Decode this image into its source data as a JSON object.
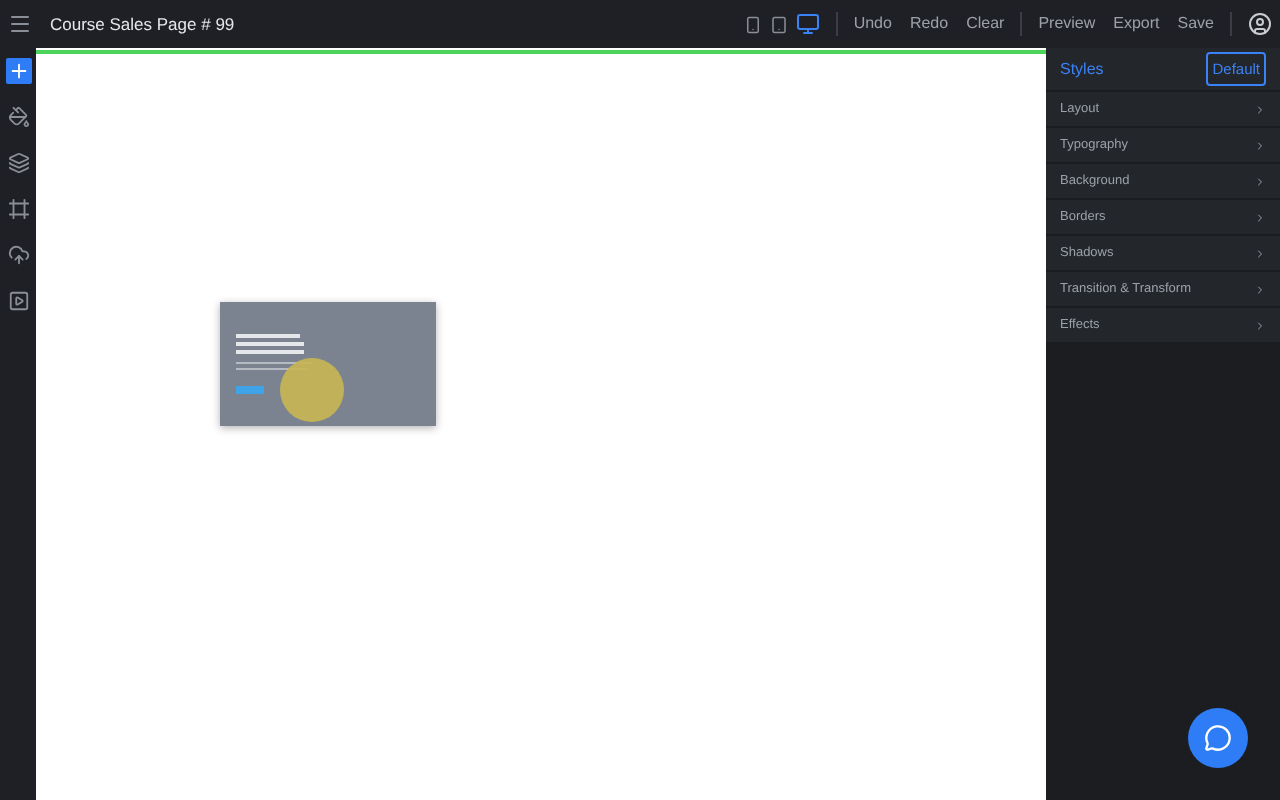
{
  "title": "Course Sales Page # 99",
  "devices": [
    {
      "kind": "phone",
      "selected": false
    },
    {
      "kind": "tablet",
      "selected": false
    },
    {
      "kind": "desktop",
      "selected": true
    }
  ],
  "actions": [
    "Undo",
    "Redo",
    "Clear"
  ],
  "file_actions": [
    "Preview",
    "Export",
    "Save"
  ],
  "tools": [
    {
      "kind": "add",
      "selected": true
    },
    {
      "kind": "paint",
      "selected": false
    },
    {
      "kind": "layers",
      "selected": false
    },
    {
      "kind": "frame",
      "selected": false
    },
    {
      "kind": "upload",
      "selected": false
    },
    {
      "kind": "play",
      "selected": false
    }
  ],
  "styles": {
    "title": "Styles",
    "state": "Default",
    "sections": [
      "Layout",
      "Typography",
      "Background",
      "Borders",
      "Shadows",
      "Transition & Transform",
      "Effects"
    ]
  }
}
